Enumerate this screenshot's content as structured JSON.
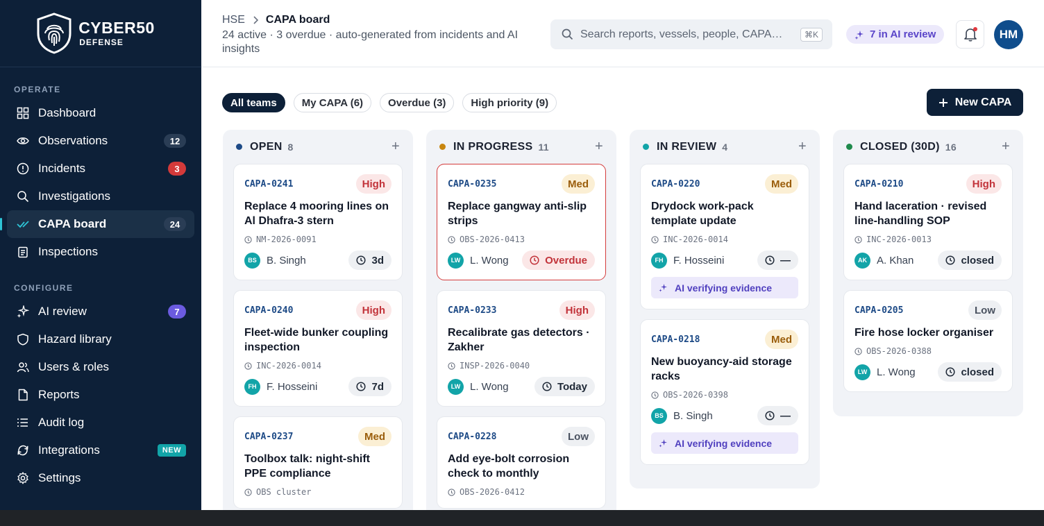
{
  "brand": {
    "name": "CYBER50",
    "sub": "DEFENSE"
  },
  "sidebar": {
    "operate_label": "OPERATE",
    "configure_label": "CONFIGURE",
    "operate": [
      {
        "label": "Dashboard",
        "icon": "grid-icon",
        "badge": ""
      },
      {
        "label": "Observations",
        "icon": "eye-icon",
        "badge": "12"
      },
      {
        "label": "Incidents",
        "icon": "alert-circle-icon",
        "badge": "3"
      },
      {
        "label": "Investigations",
        "icon": "search-icon",
        "badge": ""
      },
      {
        "label": "CAPA board",
        "icon": "check-trend-icon",
        "badge": "24"
      },
      {
        "label": "Inspections",
        "icon": "clipboard-icon",
        "badge": ""
      }
    ],
    "configure": [
      {
        "label": "AI review",
        "icon": "sparkle-icon",
        "badge": "7"
      },
      {
        "label": "Hazard library",
        "icon": "shield-icon",
        "badge": ""
      },
      {
        "label": "Users & roles",
        "icon": "users-icon",
        "badge": ""
      },
      {
        "label": "Reports",
        "icon": "document-icon",
        "badge": ""
      },
      {
        "label": "Audit log",
        "icon": "list-icon",
        "badge": ""
      },
      {
        "label": "Integrations",
        "icon": "refresh-icon",
        "badge": "NEW"
      },
      {
        "label": "Settings",
        "icon": "gear-icon",
        "badge": ""
      }
    ]
  },
  "header": {
    "crumb_root": "HSE",
    "crumb_current": "CAPA board",
    "subtitle": "24 active · 3 overdue · auto-generated from incidents and AI insights",
    "search_placeholder": "Search reports, vessels, people, CAPA…",
    "search_shortcut": "⌘K",
    "ai_review": "7 in AI review",
    "avatar": "HM"
  },
  "filters": [
    "All teams",
    "My CAPA (6)",
    "Overdue (3)",
    "High priority (9)"
  ],
  "new_button": "New CAPA",
  "columns": [
    {
      "title": "OPEN",
      "count": "8",
      "color": "#1d4a86",
      "cards": [
        {
          "id": "CAPA-0241",
          "priority": "High",
          "title": "Replace 4 mooring lines on Al Dhafra-3 stern",
          "source": "NM-2026-0091",
          "initials": "BS",
          "person": "B. Singh",
          "due": "3d"
        },
        {
          "id": "CAPA-0240",
          "priority": "High",
          "title": "Fleet-wide bunker coupling inspection",
          "source": "INC-2026-0014",
          "initials": "FH",
          "person": "F. Hosseini",
          "due": "7d"
        },
        {
          "id": "CAPA-0237",
          "priority": "Med",
          "title": "Toolbox talk: night-shift PPE compliance",
          "source": "OBS cluster",
          "initials": "",
          "person": "",
          "due": ""
        }
      ]
    },
    {
      "title": "IN PROGRESS",
      "count": "11",
      "color": "#c8860f",
      "cards": [
        {
          "id": "CAPA-0235",
          "priority": "Med",
          "title": "Replace gangway anti-slip strips",
          "source": "OBS-2026-0413",
          "initials": "LW",
          "person": "L. Wong",
          "due": "Overdue"
        },
        {
          "id": "CAPA-0233",
          "priority": "High",
          "title": "Recalibrate gas detectors · Zakher",
          "source": "INSP-2026-0040",
          "initials": "LW",
          "person": "L. Wong",
          "due": "Today"
        },
        {
          "id": "CAPA-0228",
          "priority": "Low",
          "title": "Add eye-bolt corrosion check to monthly",
          "source": "OBS-2026-0412",
          "initials": "",
          "person": "",
          "due": ""
        }
      ]
    },
    {
      "title": "IN REVIEW",
      "count": "4",
      "color": "#12a4a8",
      "cards": [
        {
          "id": "CAPA-0220",
          "priority": "Med",
          "title": "Drydock work-pack template update",
          "source": "INC-2026-0014",
          "initials": "FH",
          "person": "F. Hosseini",
          "due": "—",
          "ai": "AI verifying evidence"
        },
        {
          "id": "CAPA-0218",
          "priority": "Med",
          "title": "New buoyancy-aid storage racks",
          "source": "OBS-2026-0398",
          "initials": "BS",
          "person": "B. Singh",
          "due": "—",
          "ai": "AI verifying evidence"
        }
      ]
    },
    {
      "title": "CLOSED (30D)",
      "count": "16",
      "color": "#1f8a4c",
      "cards": [
        {
          "id": "CAPA-0210",
          "priority": "High",
          "title": "Hand laceration · revised line-handling SOP",
          "source": "INC-2026-0013",
          "initials": "AK",
          "person": "A. Khan",
          "due": "closed"
        },
        {
          "id": "CAPA-0205",
          "priority": "Low",
          "title": "Fire hose locker organiser",
          "source": "OBS-2026-0388",
          "initials": "LW",
          "person": "L. Wong",
          "due": "closed"
        }
      ]
    }
  ]
}
